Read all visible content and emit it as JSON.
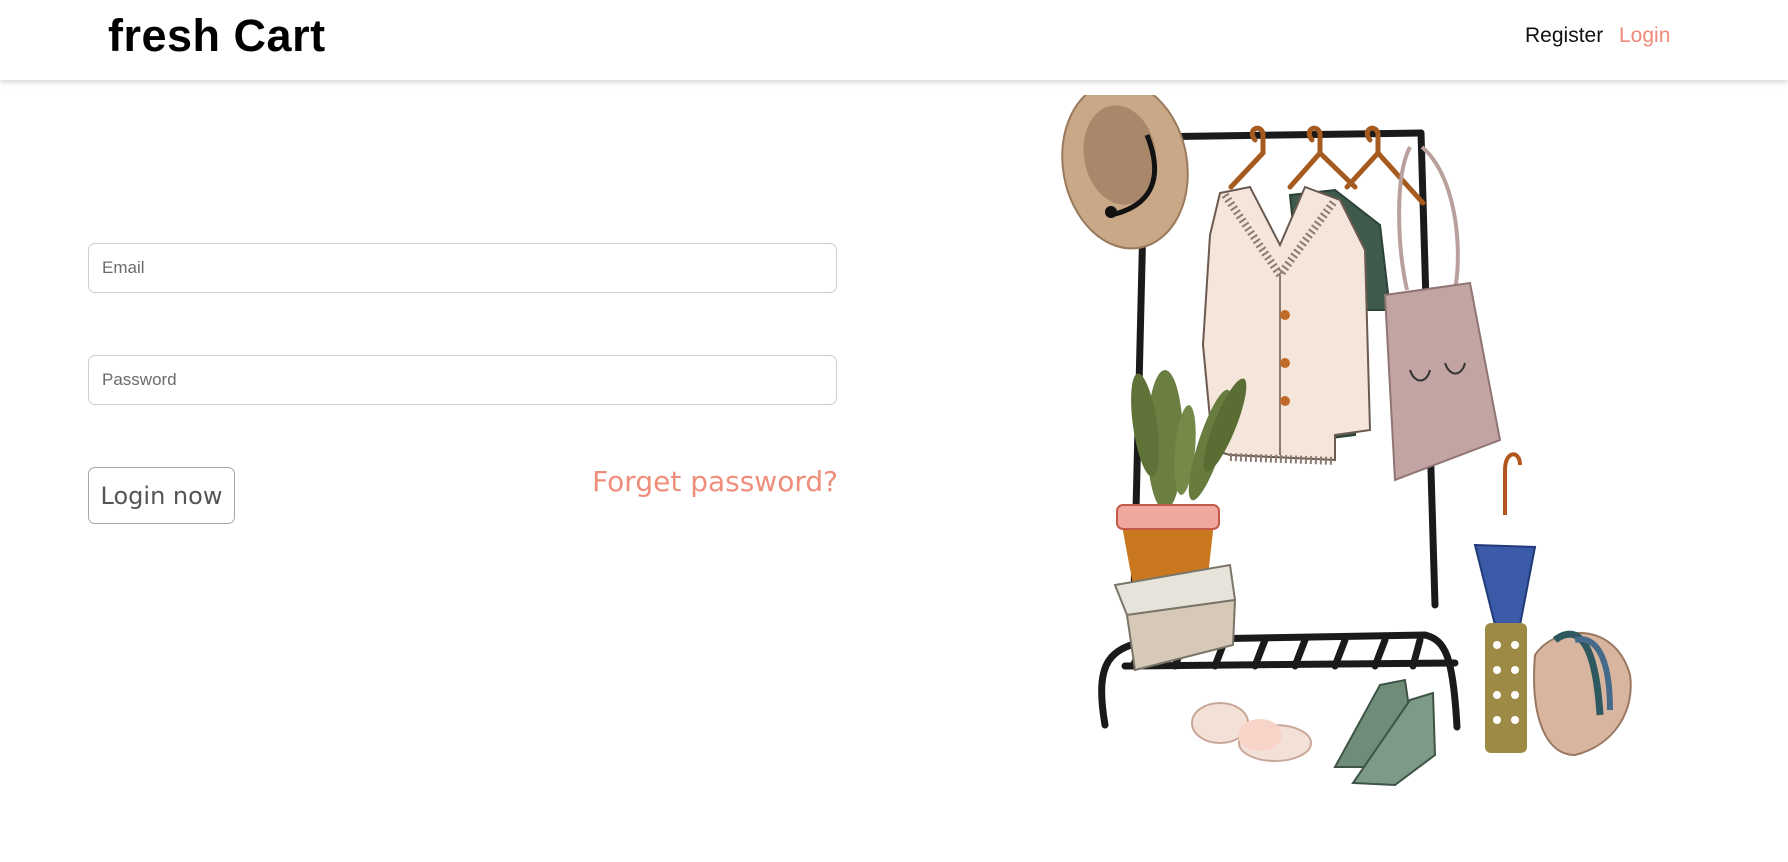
{
  "navbar": {
    "brand": "fresh Cart",
    "links": [
      {
        "label": "Register"
      },
      {
        "label": "Login",
        "active": true
      }
    ]
  },
  "form": {
    "email_placeholder": "Email",
    "password_placeholder": "Password",
    "submit_label": "Login now",
    "forget_label": "Forget password?"
  },
  "colors": {
    "accent": "#f08a78",
    "text": "#111111",
    "border": "#cfcfcf"
  },
  "illustration": {
    "icon": "clothing-rack-illustration"
  }
}
